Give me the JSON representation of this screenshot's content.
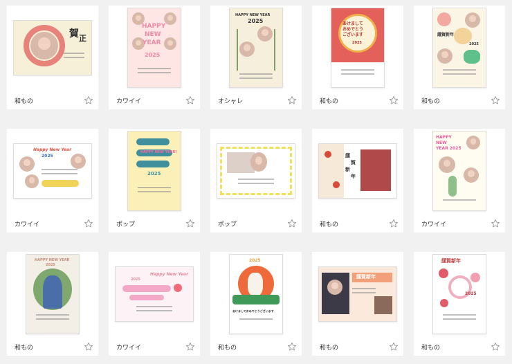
{
  "cards": [
    {
      "category": "和もの",
      "thumb_text": [
        "賀",
        "正"
      ]
    },
    {
      "category": "カワイイ",
      "thumb_text": [
        "HAPPY",
        "NEW",
        "YEAR",
        "2025"
      ]
    },
    {
      "category": "オシャレ",
      "thumb_text": [
        "HAPPY NEW YEAR",
        "2025"
      ]
    },
    {
      "category": "和もの",
      "thumb_text": [
        "あけまして",
        "おめでとう",
        "ございます",
        "2025"
      ]
    },
    {
      "category": "和もの",
      "thumb_text": [
        "謹賀新年",
        "2025"
      ]
    },
    {
      "category": "カワイイ",
      "thumb_text": [
        "Happy New Year",
        "2025"
      ]
    },
    {
      "category": "ポップ",
      "thumb_text": [
        "HAPPY NEW YEAR!",
        "2025"
      ]
    },
    {
      "category": "ポップ",
      "thumb_text": []
    },
    {
      "category": "和もの",
      "thumb_text": [
        "謹",
        "賀",
        "新",
        "年"
      ]
    },
    {
      "category": "カワイイ",
      "thumb_text": [
        "HAPPY",
        "NEW",
        "YEAR 2025"
      ]
    },
    {
      "category": "和もの",
      "thumb_text": [
        "HAPPY NEW YEAR",
        "2025"
      ]
    },
    {
      "category": "カワイイ",
      "thumb_text": [
        "Happy New Year",
        "2025"
      ]
    },
    {
      "category": "和もの",
      "thumb_text": [
        "2025",
        "あけましておめでとうございます"
      ]
    },
    {
      "category": "和もの",
      "thumb_text": [
        "謹賀新年"
      ]
    },
    {
      "category": "和もの",
      "thumb_text": [
        "謹賀新年",
        "2025"
      ]
    }
  ],
  "colors": {
    "star": "#9a9a9a",
    "page_bg": "#f1f1f1",
    "card_bg": "#ffffff"
  }
}
